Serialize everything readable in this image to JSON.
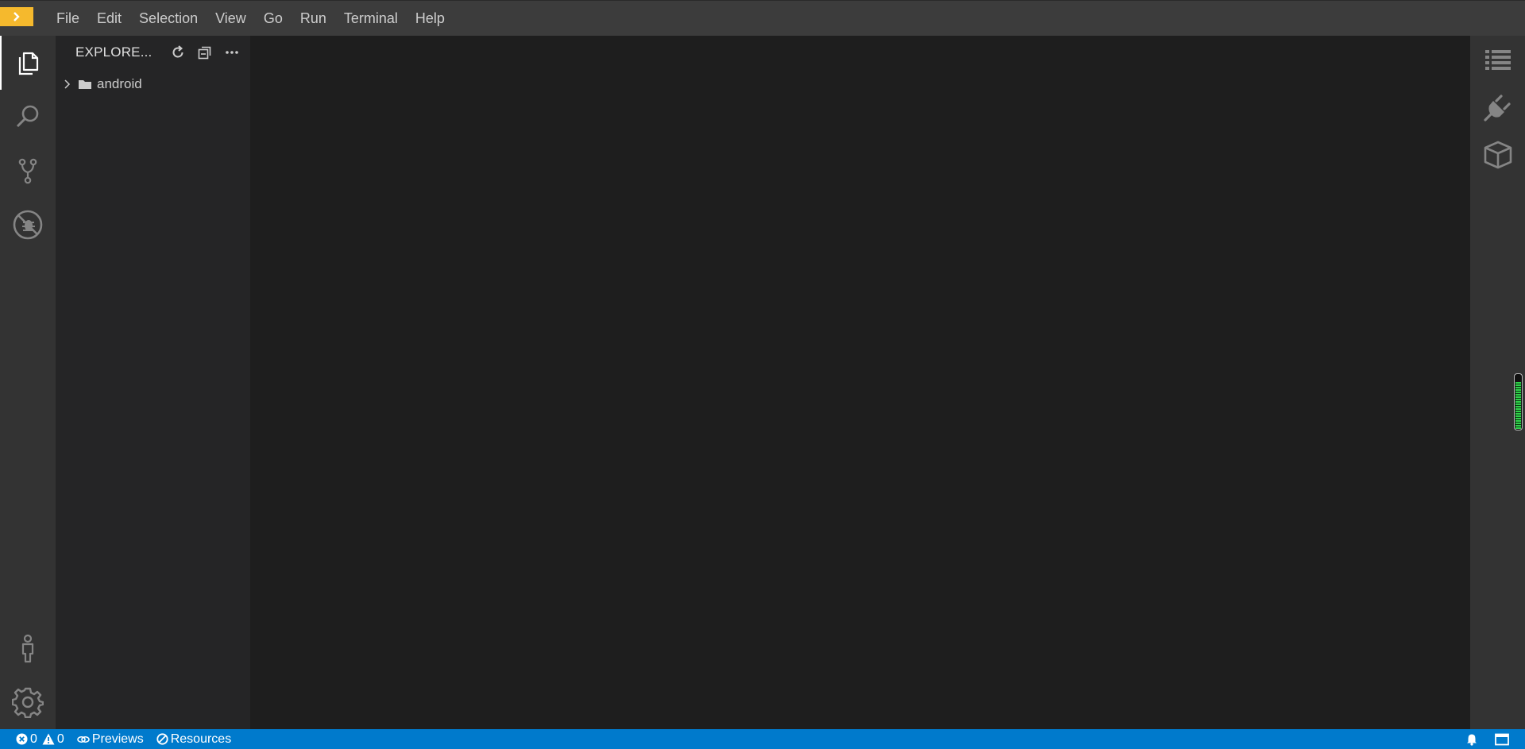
{
  "menubar": {
    "items": [
      "File",
      "Edit",
      "Selection",
      "View",
      "Go",
      "Run",
      "Terminal",
      "Help"
    ]
  },
  "activitybar": {
    "icons": [
      "files-icon",
      "search-icon",
      "source-control-icon",
      "debug-icon",
      "account-icon",
      "gear-icon"
    ]
  },
  "sidebar": {
    "title": "EXPLORE...",
    "tree": [
      {
        "label": "android",
        "expanded": false
      }
    ]
  },
  "rightbar": {
    "icons": [
      "outline-icon",
      "plugin-icon",
      "package-icon"
    ],
    "meter_level": 0.85
  },
  "statusbar": {
    "errors": "0",
    "warnings": "0",
    "previews_label": "Previews",
    "resources_label": "Resources"
  },
  "colors": {
    "accent": "#f5b92d",
    "statusbar": "#007acc",
    "meter": "#2fd14a"
  }
}
